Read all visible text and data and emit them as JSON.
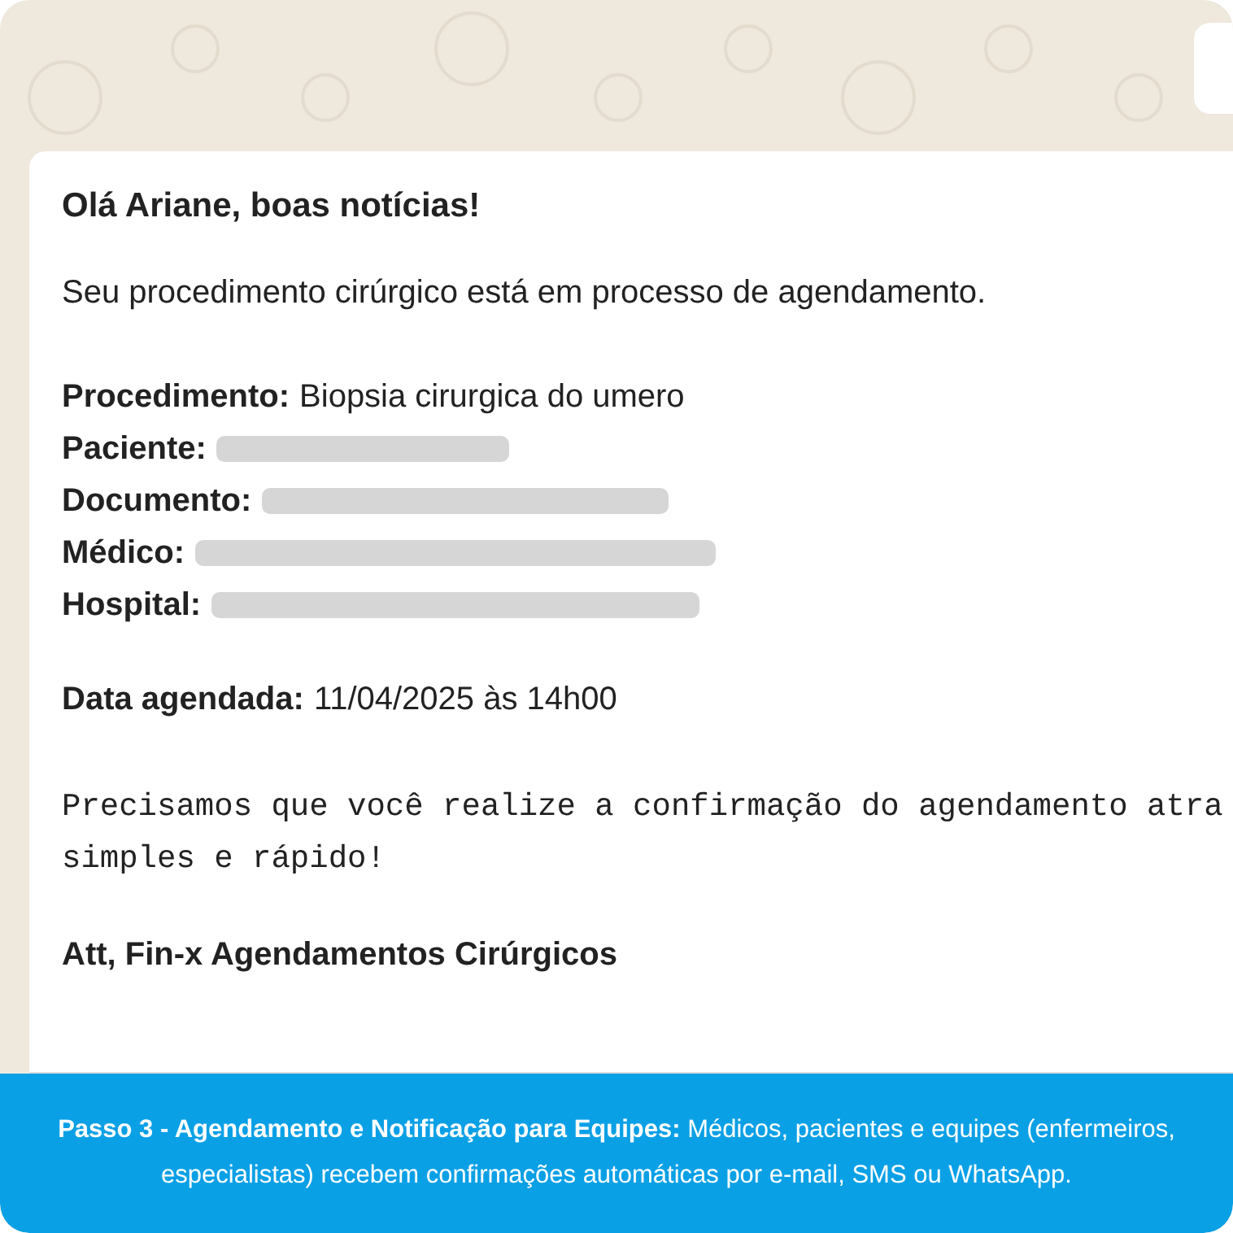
{
  "message": {
    "greeting": "Olá Ariane, boas notícias!",
    "intro": "Seu procedimento cirúrgico está em processo de agendamento.",
    "fields": [
      {
        "label": "Procedimento:",
        "value": "Biopsia cirurgica do umero",
        "redacted": false
      },
      {
        "label": "Paciente:",
        "redacted": true
      },
      {
        "label": "Documento:",
        "redacted": true
      },
      {
        "label": "Médico:",
        "redacted": true
      },
      {
        "label": "Hospital:",
        "redacted": true
      }
    ],
    "date_label": "Data agendada:",
    "date_value": "11/04/2025 às 14h00",
    "request_lines": [
      "Precisamos que você realize a confirmação do agendamento atra",
      "simples e rápido!"
    ],
    "signature": "Att, Fin-x Agendamentos Cirúrgicos"
  },
  "caption": "**Passo 3 - Agendamento e Notificação para Equipes:** Médicos, pacientes e equipes (enfermeiros, especialistas) recebem confirmações automáticas por e-mail, SMS ou WhatsApp."
}
